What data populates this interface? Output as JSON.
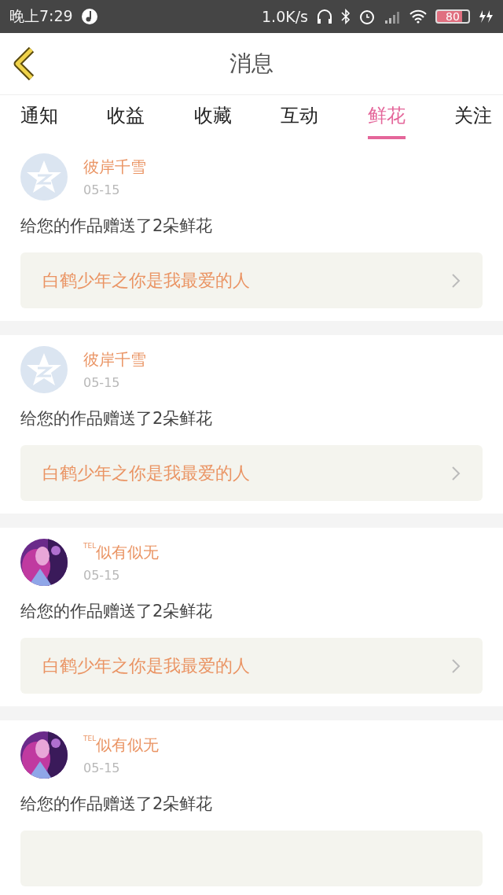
{
  "status_bar": {
    "time": "晚上7:29",
    "speed": "1.0K/s",
    "battery": "80"
  },
  "header": {
    "title": "消息"
  },
  "tabs": [
    {
      "label": "通知",
      "selected": false
    },
    {
      "label": "收益",
      "selected": false
    },
    {
      "label": "收藏",
      "selected": false
    },
    {
      "label": "互动",
      "selected": false
    },
    {
      "label": "鲜花",
      "selected": true
    },
    {
      "label": "关注",
      "selected": false
    }
  ],
  "messages": [
    {
      "avatar": {
        "kind": "default"
      },
      "name": "彼岸千雪",
      "date": "05-15",
      "text": "给您的作品赠送了2朵鲜花",
      "work": "白鹤少年之你是我最爱的人"
    },
    {
      "avatar": {
        "kind": "default"
      },
      "name": "彼岸千雪",
      "date": "05-15",
      "text": "给您的作品赠送了2朵鲜花",
      "work": "白鹤少年之你是我最爱的人"
    },
    {
      "name": "$^{TEL}$似有似无",
      "date": "05-15",
      "text": "给您的作品赠送了2朵鲜花",
      "work": "白鹤少年之你是我最爱的人"
    },
    {
      "name": "$^{TEL}$似有似无",
      "date": "05-15",
      "text": "给您的作品赠送了2朵鲜花"
    }
  ]
}
